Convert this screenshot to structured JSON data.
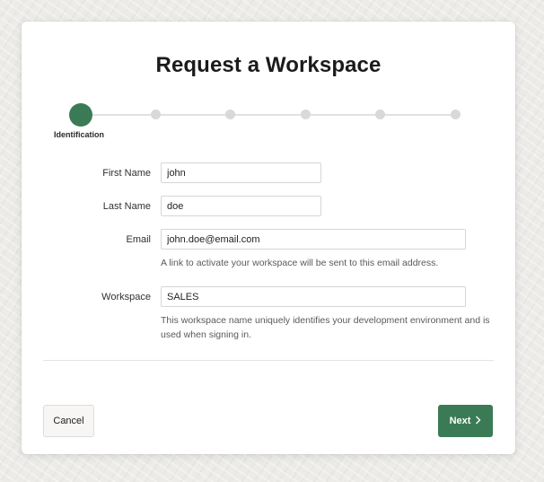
{
  "dialog": {
    "title": "Request a Workspace"
  },
  "wizard": {
    "current_step_label": "Identification",
    "total_steps": 6,
    "current_step": 1
  },
  "form": {
    "first_name": {
      "label": "First Name",
      "value": "john"
    },
    "last_name": {
      "label": "Last Name",
      "value": "doe"
    },
    "email": {
      "label": "Email",
      "value": "john.doe@email.com",
      "help": "A link to activate your workspace will be sent to this email address."
    },
    "workspace": {
      "label": "Workspace",
      "value": "SALES",
      "help": "This workspace name uniquely identifies your development environment and is used when signing in."
    }
  },
  "buttons": {
    "cancel_label": "Cancel",
    "next_label": "Next",
    "next_icon": "chevron-right-icon"
  },
  "colors": {
    "accent": "#3a7b55",
    "inactive_step": "#d9d9d9"
  }
}
